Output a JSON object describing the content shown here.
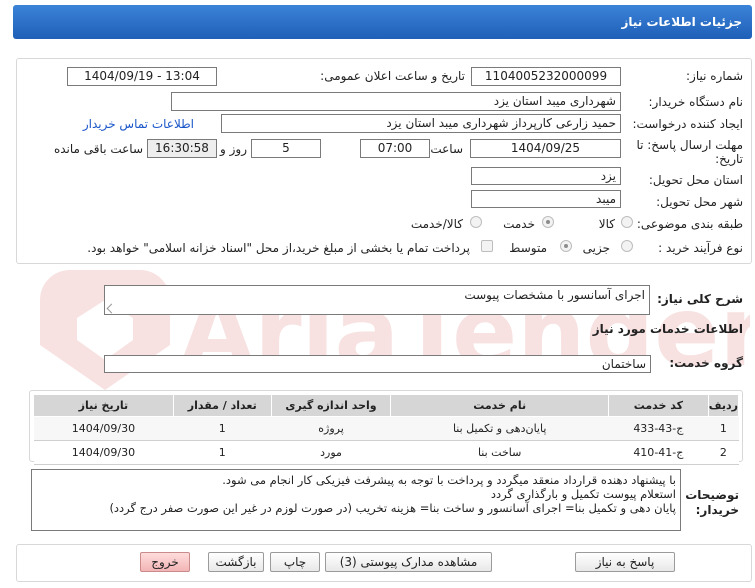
{
  "header": {
    "title": "جزئیات اطلاعات نیاز"
  },
  "form": {
    "need_number_label": "شماره نیاز:",
    "need_number": "1104005232000099",
    "announce_label": "تاریخ و ساعت اعلان عمومی:",
    "announce_value": "1404/09/19 - 13:04",
    "buyer_org_label": "نام دستگاه خریدار:",
    "buyer_org": "شهرداری میبد استان یزد",
    "requester_label": "ایجاد کننده درخواست:",
    "requester": "حمید زارعی کارپرداز شهرداری میبد استان یزد",
    "contact_link": "اطلاعات تماس خریدار",
    "deadline_label_1": "مهلت ارسال پاسخ: تا",
    "deadline_label_2": "تاریخ:",
    "deadline_date": "1404/09/25",
    "time_label": "ساعت",
    "deadline_time": "07:00",
    "days_value": "5",
    "days_label": "روز و",
    "remaining_time": "16:30:58",
    "remaining_label": "ساعت باقی مانده",
    "province_label": "استان محل تحویل:",
    "province": "یزد",
    "city_label": "شهر محل تحویل:",
    "city": "میبد",
    "category_label": "طبقه بندی موضوعی:",
    "category_options": [
      "کالا",
      "خدمت",
      "کالا/خدمت"
    ],
    "category_selected": 1,
    "process_label": "نوع فرآیند خرید :",
    "process_options": [
      "جزیی",
      "متوسط"
    ],
    "process_selected": 1,
    "payment_note": "پرداخت تمام یا بخشی از مبلغ خرید،از محل \"اسناد خزانه اسلامی\" خواهد بود."
  },
  "summary": {
    "label": "شرح کلی نیاز:",
    "value": "اجرای آسانسور با مشخصات پیوست"
  },
  "services": {
    "section_title": "اطلاعات خدمات مورد نیاز",
    "group_label": "گروه خدمت:",
    "group_value": "ساختمان",
    "columns": [
      "ردیف",
      "کد خدمت",
      "نام خدمت",
      "واحد اندازه گیری",
      "تعداد / مقدار",
      "تاریخ نیاز"
    ],
    "rows": [
      [
        "1",
        "ج-43-433",
        "پایان‌دهی و تکمیل بنا",
        "پروژه",
        "1",
        "1404/09/30"
      ],
      [
        "2",
        "ج-41-410",
        "ساخت بنا",
        "مورد",
        "1",
        "1404/09/30"
      ]
    ]
  },
  "notes": {
    "label_1": "توضیحات",
    "label_2": "خریدار:",
    "lines": [
      "با پیشنهاد دهنده قرارداد منعقد میگردد و پرداخت با توجه به پیشرفت فیزیکی کار انجام می شود.",
      "استعلام پیوست تکمیل و بارگذاری گردد",
      "پایان دهی و تکمیل بنا=  اجرای آسانسور و ساخت بنا= هزینه تخریب (در صورت لوزم در غیر این صورت صفر درج گردد)"
    ]
  },
  "buttons": {
    "reply": "پاسخ به نیاز",
    "docs": "مشاهده مدارک پیوستی (3)",
    "print": "چاپ",
    "back": "بازگشت",
    "exit": "خروج"
  },
  "watermark": {
    "text": "AriaTender.net"
  },
  "colors": {
    "header": "#2a6fc9",
    "link": "#1a56c9",
    "watermark": "#f2c9c9"
  }
}
